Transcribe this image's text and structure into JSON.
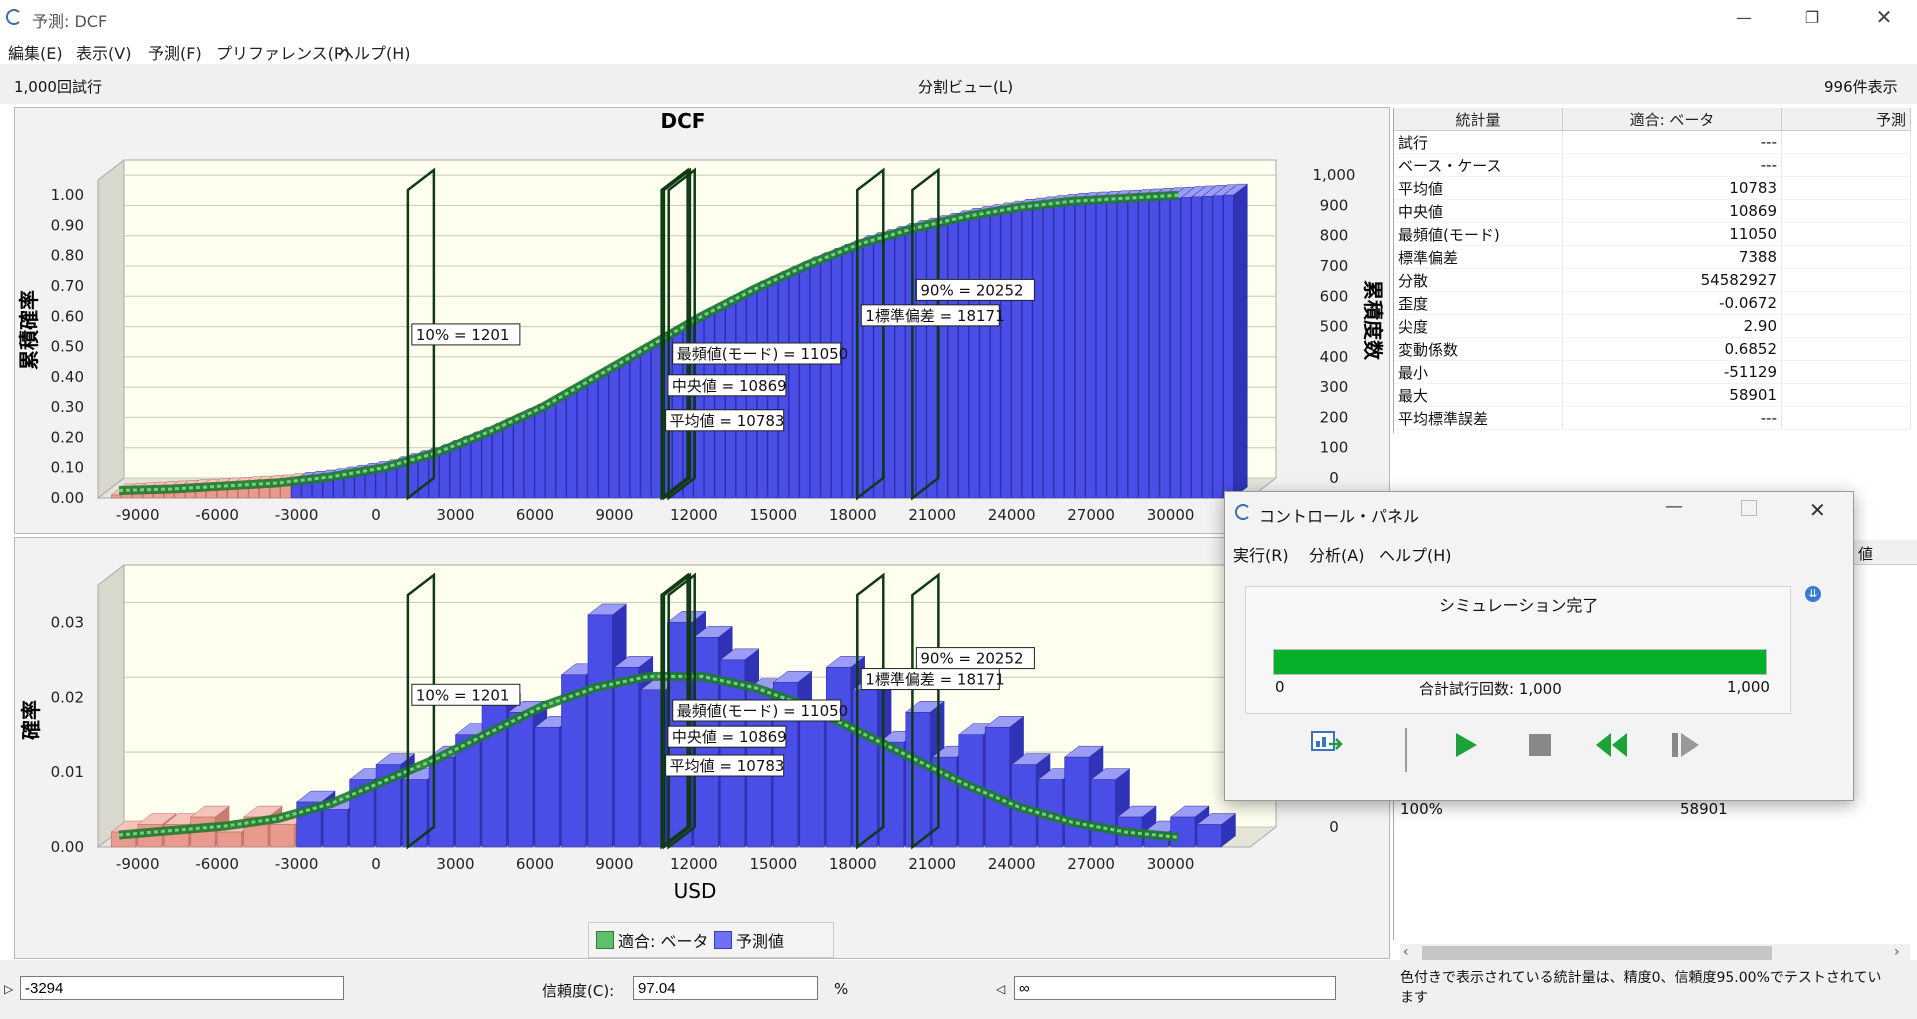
{
  "window": {
    "title": "予測: DCF"
  },
  "menu": [
    "編集(E)",
    "表示(V)",
    "予測(F)",
    "プリファレンス(P)",
    "ヘルプ(H)"
  ],
  "header": {
    "trials": "1,000回試行",
    "view": "分割ビュー(L)",
    "displayed": "996件表示"
  },
  "chart_data": [
    {
      "type": "bar",
      "title": "DCF",
      "ylabel": "累積確率",
      "y2label": "累積度数",
      "xlabel": "",
      "x_ticks": [
        -9000,
        -6000,
        -3000,
        0,
        3000,
        6000,
        9000,
        12000,
        15000,
        18000,
        21000,
        24000,
        27000,
        30000
      ],
      "y_ticks": [
        "0.00",
        "0.10",
        "0.20",
        "0.30",
        "0.40",
        "0.50",
        "0.60",
        "0.70",
        "0.80",
        "0.90",
        "1.00"
      ],
      "y2_ticks": [
        "0",
        "100",
        "200",
        "300",
        "400",
        "500",
        "600",
        "700",
        "800",
        "900",
        "1,000"
      ],
      "ylim": [
        0,
        1.05
      ],
      "series": [
        {
          "name": "予測値",
          "x": [
            -10000,
            -8000,
            -6000,
            -4000,
            -3000,
            -2000,
            0,
            2000,
            4000,
            6000,
            8000,
            10000,
            12000,
            14000,
            16000,
            18000,
            20000,
            22000,
            24000,
            26000,
            28000,
            30000,
            32000
          ],
          "values": [
            0.01,
            0.02,
            0.03,
            0.04,
            0.05,
            0.06,
            0.09,
            0.14,
            0.21,
            0.29,
            0.39,
            0.49,
            0.59,
            0.68,
            0.76,
            0.83,
            0.88,
            0.92,
            0.95,
            0.97,
            0.98,
            0.99,
            1.0
          ]
        },
        {
          "name": "適合: ベータ",
          "x": [
            -10000,
            -8000,
            -6000,
            -4000,
            -2000,
            0,
            2000,
            4000,
            6000,
            8000,
            10000,
            12000,
            14000,
            16000,
            18000,
            20000,
            22000,
            24000,
            26000,
            28000,
            30000
          ],
          "values": [
            0.005,
            0.01,
            0.02,
            0.03,
            0.05,
            0.08,
            0.13,
            0.2,
            0.28,
            0.38,
            0.48,
            0.58,
            0.67,
            0.75,
            0.82,
            0.87,
            0.91,
            0.94,
            0.96,
            0.97,
            0.98
          ]
        }
      ],
      "markers": [
        {
          "value": 1201,
          "label": "10% = 1201"
        },
        {
          "value": 10783,
          "label": "平均値 = 10783"
        },
        {
          "value": 10869,
          "label": "中央値 = 10869"
        },
        {
          "value": 11050,
          "label": "最頻値(モード) = 11050"
        },
        {
          "value": 18171,
          "label": "1標準偏差 = 18171"
        },
        {
          "value": 20252,
          "label": "90% = 20252"
        }
      ]
    },
    {
      "type": "bar",
      "title": "",
      "ylabel": "確率",
      "xlabel": "USD",
      "x_ticks": [
        -9000,
        -6000,
        -3000,
        0,
        3000,
        6000,
        9000,
        12000,
        15000,
        18000,
        21000,
        24000,
        27000,
        30000
      ],
      "y_ticks": [
        "0.00",
        "0.01",
        "0.02",
        "0.03"
      ],
      "y2_ticks": [
        "0"
      ],
      "ylim": [
        0,
        0.035
      ],
      "series": [
        {
          "name": "予測値",
          "x": [
            -10000,
            -9000,
            -8000,
            -7000,
            -6000,
            -5000,
            -4000,
            -3000,
            -2000,
            -1000,
            0,
            1000,
            2000,
            3000,
            4000,
            5000,
            6000,
            7000,
            8000,
            9000,
            10000,
            11000,
            12000,
            13000,
            14000,
            15000,
            16000,
            17000,
            18000,
            19000,
            20000,
            21000,
            22000,
            23000,
            24000,
            25000,
            26000,
            27000,
            28000,
            29000,
            30000,
            31000
          ],
          "values": [
            0.002,
            0.003,
            0.003,
            0.004,
            0.002,
            0.004,
            0.003,
            0.006,
            0.005,
            0.009,
            0.011,
            0.009,
            0.012,
            0.015,
            0.019,
            0.018,
            0.016,
            0.023,
            0.031,
            0.024,
            0.021,
            0.03,
            0.028,
            0.025,
            0.021,
            0.022,
            0.018,
            0.024,
            0.021,
            0.014,
            0.018,
            0.012,
            0.015,
            0.016,
            0.011,
            0.009,
            0.012,
            0.009,
            0.004,
            0.002,
            0.004,
            0.003
          ]
        },
        {
          "name": "適合: ベータ",
          "x": [
            -10000,
            -8000,
            -6000,
            -4000,
            -2000,
            0,
            2000,
            4000,
            6000,
            8000,
            10000,
            12000,
            14000,
            16000,
            18000,
            20000,
            22000,
            24000,
            26000,
            28000,
            30000
          ],
          "values": [
            0.0008,
            0.0014,
            0.002,
            0.003,
            0.005,
            0.008,
            0.011,
            0.0145,
            0.018,
            0.0205,
            0.022,
            0.022,
            0.0205,
            0.018,
            0.0145,
            0.011,
            0.0075,
            0.0045,
            0.0025,
            0.0012,
            0.0005
          ]
        }
      ],
      "markers": [
        {
          "value": 1201,
          "label": "10% = 1201"
        },
        {
          "value": 10783,
          "label": "平均値 = 10783"
        },
        {
          "value": 10869,
          "label": "中央値 = 10869"
        },
        {
          "value": 11050,
          "label": "最頻値(モード) = 11050"
        },
        {
          "value": 18171,
          "label": "1標準偏差 = 18171"
        },
        {
          "value": 20252,
          "label": "90% = 20252"
        }
      ]
    }
  ],
  "legend": [
    "適合: ベータ",
    "予測値"
  ],
  "stats": {
    "headers": [
      "統計量",
      "適合: ベータ",
      "予測"
    ],
    "rows": [
      [
        "試行",
        "---"
      ],
      [
        "ベース・ケース",
        "---"
      ],
      [
        "平均値",
        "10783"
      ],
      [
        "中央値",
        "10869"
      ],
      [
        "最頻値(モード)",
        "11050"
      ],
      [
        "標準偏差",
        "7388"
      ],
      [
        "分散",
        "54582927"
      ],
      [
        "歪度",
        "-0.0672"
      ],
      [
        "尖度",
        "2.90"
      ],
      [
        "変動係数",
        "0.6852"
      ],
      [
        "最小",
        "-51129"
      ],
      [
        "最大",
        "58901"
      ],
      [
        "平均標準誤差",
        "---"
      ]
    ]
  },
  "percentile": {
    "header": "値",
    "last_label": "100%",
    "last_value": "58901"
  },
  "bottom": {
    "left_value": "-3294",
    "certainty_label": "信頼度(C):",
    "certainty_value": "97.04",
    "percent": "%",
    "right_value": "∞",
    "note": "色付きで表示されている統計量は、精度0、信頼度95.00%でテストされています"
  },
  "control_panel": {
    "title": "コントロール・パネル",
    "menu": [
      "実行(R)",
      "分析(A)",
      "ヘルプ(H)"
    ],
    "status": "シミュレーション完了",
    "progress": 1.0,
    "progress_min": "0",
    "progress_max": "1,000",
    "progress_text": "合計試行回数: 1,000"
  },
  "colors": {
    "bar": "#4a4ee6",
    "bar_tail": "#e89a8c",
    "fit": "#2e8b3a",
    "progress": "#06b02a",
    "plot_bg": "#fffff0"
  }
}
